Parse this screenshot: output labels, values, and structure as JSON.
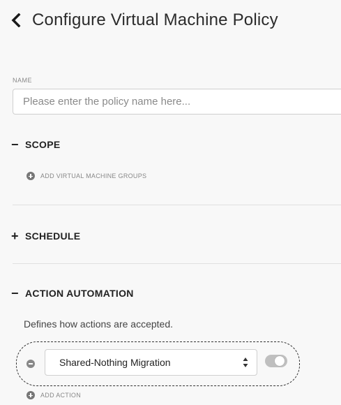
{
  "header": {
    "back_icon": "chevron-left-icon",
    "title": "Configure Virtual Machine Policy"
  },
  "name_field": {
    "label": "NAME",
    "value": "",
    "placeholder": "Please enter the policy name here..."
  },
  "sections": {
    "scope": {
      "toggle": "−",
      "title": "SCOPE",
      "add_label": "ADD VIRTUAL MACHINE GROUPS",
      "expanded": true
    },
    "schedule": {
      "toggle": "+",
      "title": "SCHEDULE",
      "expanded": false
    },
    "action_automation": {
      "toggle": "−",
      "title": "ACTION AUTOMATION",
      "expanded": true,
      "description": "Defines how actions are accepted.",
      "action_select": {
        "selected": "Shared-Nothing Migration"
      },
      "action_toggle": {
        "enabled": false
      },
      "add_label": "ADD ACTION"
    }
  },
  "colors": {
    "background": "#f8f8f8",
    "text": "#222222",
    "muted": "#888888",
    "toggle_off": "#bfbfbf"
  }
}
